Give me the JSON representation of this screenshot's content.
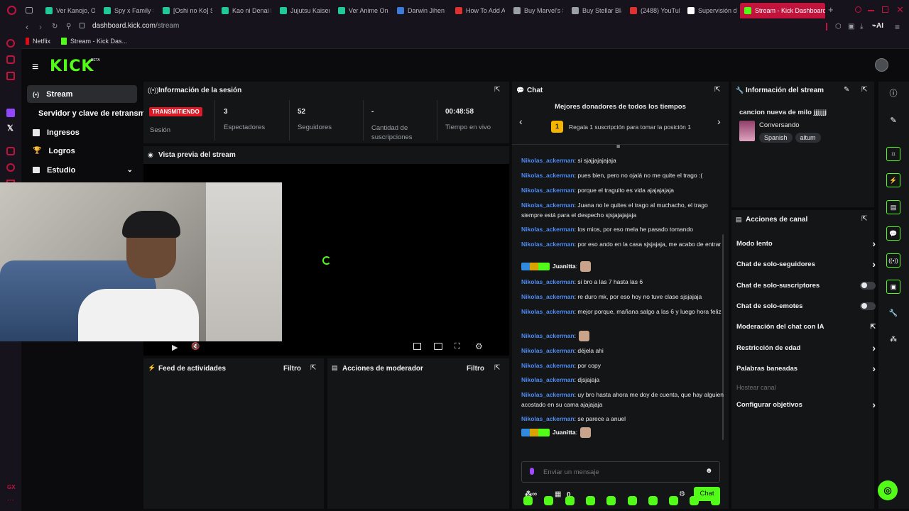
{
  "browser": {
    "tabs": [
      {
        "label": "Ver Kanojo, Ok",
        "color": "#20c997"
      },
      {
        "label": "Spy x Family S",
        "color": "#20c997"
      },
      {
        "label": "[Oshi no Ko] S",
        "color": "#20c997"
      },
      {
        "label": "Kao ni Denai K",
        "color": "#20c997"
      },
      {
        "label": "Jujutsu Kaisen",
        "color": "#20c997"
      },
      {
        "label": "Ver Anime On",
        "color": "#20c997"
      },
      {
        "label": "Darwin Jihen",
        "color": "#3d7bd9"
      },
      {
        "label": "How To Add A",
        "color": "#e03131"
      },
      {
        "label": "Buy Marvel's S",
        "color": "#9aa0a6"
      },
      {
        "label": "Buy Stellar Bla",
        "color": "#9aa0a6"
      },
      {
        "label": "(2488) YouTub",
        "color": "#e03131"
      },
      {
        "label": "Supervisión d",
        "color": "#ffffff"
      },
      {
        "label": "Stream - Kick Dashboard",
        "color": "#53fc18"
      }
    ],
    "url_host": "dashboard.kick.com",
    "url_path": "/stream",
    "bookmarks": [
      {
        "label": "Netflix",
        "color": "#e50914"
      },
      {
        "label": "Stream - Kick Das...",
        "color": "#53fc18"
      }
    ],
    "sidebar_badge": "GX"
  },
  "kick": {
    "logo": "KICK",
    "logo_badge": "BETA",
    "accent": "#53fc18",
    "nav": [
      {
        "label": "Stream",
        "icon": "broadcast-icon"
      },
      {
        "label": "Servidor y clave de retransmisión",
        "icon": ""
      },
      {
        "label": "Ingresos",
        "icon": "grid-icon"
      },
      {
        "label": "Logros",
        "icon": "trophy-icon"
      },
      {
        "label": "Estudio",
        "icon": "studio-icon"
      }
    ]
  },
  "session": {
    "title": "Información de la sesión",
    "status": "TRANSMITIENDO",
    "status_label": "Sesión",
    "stats": [
      {
        "value": "3",
        "label": "Espectadores"
      },
      {
        "value": "52",
        "label": "Seguidores"
      },
      {
        "value": "-",
        "label": "Cantidad de suscripciones"
      },
      {
        "value": "00:48:58",
        "label": "Tiempo en vivo"
      }
    ]
  },
  "preview": {
    "title": "Vista previa del stream"
  },
  "activity": {
    "title": "Feed de actividades",
    "filter": "Filtro"
  },
  "moderator": {
    "title": "Acciones de moderador",
    "filter": "Filtro"
  },
  "chat": {
    "title": "Chat",
    "top_donors_title": "Mejores donadores de todos los tiempos",
    "rank": "1",
    "promo": "Regala 1 suscripción para tomar la posición 1",
    "messages": [
      {
        "user": "Nikolas_ackerman",
        "text": ": si sjajjajajajaja"
      },
      {
        "user": "Nikolas_ackerman",
        "text": ": pues bien, pero no ojalá no me quite el trago :("
      },
      {
        "user": "Nikolas_ackerman",
        "text": ": porque el traguito es vida ajajajajaja"
      },
      {
        "user": "Nikolas_ackerman",
        "text": ": Juana no le quites el trago al muchacho, el trago siempre está para el despecho sjsjajajajaja"
      },
      {
        "user": "Nikolas_ackerman",
        "text": ": los mios, por eso mela he pasado tomando"
      },
      {
        "user": "Nikolas_ackerman",
        "text": ": por eso ando en la casa sjsjajaja, me acabo de entrar"
      },
      {
        "user": "Juanitta",
        "text": ":"
      },
      {
        "user": "Nikolas_ackerman",
        "text": ": si bro a las 7 hasta las 6"
      },
      {
        "user": "Nikolas_ackerman",
        "text": ": re duro mk, por eso hoy no tuve clase sjsjajaja"
      },
      {
        "user": "Nikolas_ackerman",
        "text": ": mejor porque, mañana salgo a las 6 y luego hora feliz"
      },
      {
        "user": "Nikolas_ackerman",
        "text": ":"
      },
      {
        "user": "Nikolas_ackerman",
        "text": ": déjela ahi"
      },
      {
        "user": "Nikolas_ackerman",
        "text": ": por copy"
      },
      {
        "user": "Nikolas_ackerman",
        "text": ": djsjajaja"
      },
      {
        "user": "Nikolas_ackerman",
        "text": ": uy bro hasta ahora me doy de cuenta, que hay alguien acostado en su cama ajajajaja"
      },
      {
        "user": "Nikolas_ackerman",
        "text": ": se parece a anuel"
      },
      {
        "user": "Juanitta",
        "text": ":"
      }
    ],
    "input_placeholder": "Enviar un mensaje",
    "points": "0",
    "send_label": "Chat"
  },
  "stream_info": {
    "title": "Información del stream",
    "stream_title": "cancion nueva de milo jjjjjjj",
    "category": "Conversando",
    "tags": [
      "Spanish",
      "aitum"
    ]
  },
  "channel_actions": {
    "title": "Acciones de canal",
    "items": [
      {
        "label": "Modo lento",
        "control": "chevron"
      },
      {
        "label": "Chat de solo-seguidores",
        "control": "chevron"
      },
      {
        "label": "Chat de solo-suscriptores",
        "control": "toggle"
      },
      {
        "label": "Chat de solo-emotes",
        "control": "toggle"
      },
      {
        "label": "Moderación del chat con IA",
        "control": "external"
      },
      {
        "label": "Restricción de edad",
        "control": "chevron"
      },
      {
        "label": "Palabras baneadas",
        "control": "chevron"
      },
      {
        "label": "Hostear canal",
        "control": "none"
      },
      {
        "label": "Configurar objetivos",
        "control": "chevron"
      }
    ]
  }
}
